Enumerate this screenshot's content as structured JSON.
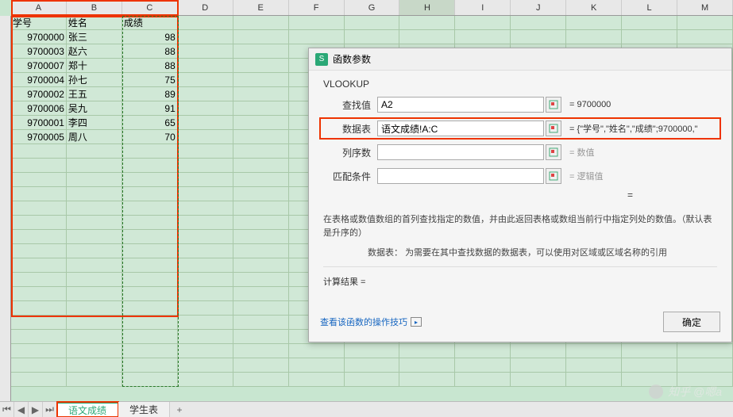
{
  "columns": [
    "A",
    "B",
    "C",
    "D",
    "E",
    "F",
    "G",
    "H",
    "I",
    "J",
    "K",
    "L",
    "M"
  ],
  "selected_col_index": 7,
  "headers": {
    "A": "学号",
    "B": "姓名",
    "C": "成绩"
  },
  "rows": [
    {
      "id": "9700000",
      "name": "张三",
      "score": "98"
    },
    {
      "id": "9700003",
      "name": "赵六",
      "score": "88"
    },
    {
      "id": "9700007",
      "name": "郑十",
      "score": "88"
    },
    {
      "id": "9700004",
      "name": "孙七",
      "score": "75"
    },
    {
      "id": "9700002",
      "name": "王五",
      "score": "89"
    },
    {
      "id": "9700006",
      "name": "吴九",
      "score": "91"
    },
    {
      "id": "9700001",
      "name": "李四",
      "score": "65"
    },
    {
      "id": "9700005",
      "name": "周八",
      "score": "70"
    }
  ],
  "dialog": {
    "title": "函数参数",
    "func_name": "VLOOKUP",
    "params": {
      "lookup_label": "查找值",
      "lookup_value": "A2",
      "lookup_result": "= 9700000",
      "table_label": "数据表",
      "table_value": "语文成绩!A:C",
      "table_result": "= {\"学号\",\"姓名\",\"成绩\";9700000,\"",
      "col_label": "列序数",
      "col_value": "",
      "col_result": "= 数值",
      "match_label": "匹配条件",
      "match_value": "",
      "match_result": "= 逻辑值"
    },
    "overall_eq": "=",
    "description": "在表格或数值数组的首列查找指定的数值，并由此返回表格或数组当前行中指定列处的数值。（默认表是升序的）",
    "param_desc_label": "数据表：",
    "param_desc": "为需要在其中查找数据的数据表，可以使用对区域或区域名称的引用",
    "calc_result_label": "计算结果 =",
    "calc_result_value": "",
    "help_link": "查看该函数的操作技巧",
    "ok_btn": "确定"
  },
  "tabs": {
    "active": "语文成绩",
    "other": "学生表"
  },
  "watermark": "知乎 @嗯a"
}
